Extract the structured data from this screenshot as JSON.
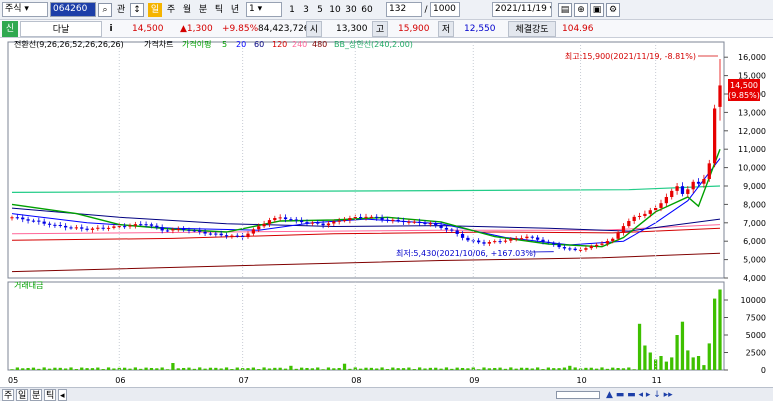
{
  "toolbar": {
    "market": "주식",
    "code": "064260",
    "search_icon": "search-icon",
    "related": "관",
    "pct_mode": "↕",
    "period_badge": "일",
    "periods": [
      "주",
      "월",
      "분",
      "틱",
      "년"
    ],
    "interval": "1",
    "intervals": [
      "1",
      "3",
      "5",
      "10",
      "30",
      "60"
    ],
    "display_count": "132",
    "count_sep": "/",
    "max_count": "1000",
    "date": "2021/11/19",
    "tool_icons": [
      "print-icon",
      "zoom-icon",
      "save-icon",
      "settings-icon"
    ]
  },
  "info": {
    "badge": "신",
    "name": "다날",
    "info_icon": "i",
    "price": "14,500",
    "change": "▲1,300",
    "change_pct": "+9.85%",
    "volume": "84,423,726",
    "open_label": "시",
    "open": "13,300",
    "high_label": "고",
    "high": "15,900",
    "low_label": "저",
    "low": "12,550",
    "strength_label": "체결강도",
    "strength": "104.96"
  },
  "legend": {
    "ichimoku": "전환선(9,26,26,52,26,26,26)",
    "price_chart": "가격차트",
    "ma_label": "가격이평",
    "ma_periods": [
      "5",
      "20",
      "60",
      "120",
      "240",
      "480"
    ],
    "ma_colors": [
      "#00a000",
      "#0000ff",
      "#000080",
      "#d40000",
      "#ff6699",
      "#800000"
    ],
    "bb": "BB_상한선(240,2.00)",
    "volume_pane": "거래대금"
  },
  "annotations": {
    "high": "최고:15,900(2021/11/19, -8.81%)",
    "low": "최저:5,430(2021/10/06, +167.03%)",
    "last_price": "14,500",
    "last_pct": "(9.85%)"
  },
  "colors": {
    "up": "#e60000",
    "down": "#0000e6",
    "volume": "#3ec000",
    "bb_upper": "#22cc88",
    "ichimoku_conv": "#00a000",
    "ichimoku_base": "#0000ff"
  },
  "chart_data": {
    "type": "candlestick",
    "xlabels": [
      "05",
      "06",
      "07",
      "08",
      "09",
      "10",
      "11"
    ],
    "ylim": [
      4000,
      16500
    ],
    "yticks": [
      4000,
      5000,
      6000,
      7000,
      8000,
      9000,
      10000,
      11000,
      12000,
      13000,
      14000,
      15000,
      16000
    ],
    "ytick_labels": [
      "4,000",
      "5,000",
      "6,000",
      "7,000",
      "8,000",
      "9,000",
      "10,000",
      "11,000",
      "12,000",
      "13,000",
      "14,000",
      "15,000",
      "16,000"
    ],
    "close_path": [
      [
        0,
        7300
      ],
      [
        4,
        7100
      ],
      [
        8,
        6850
      ],
      [
        14,
        6650
      ],
      [
        20,
        6800
      ],
      [
        25,
        6950
      ],
      [
        28,
        6600
      ],
      [
        32,
        6650
      ],
      [
        36,
        6450
      ],
      [
        40,
        6300
      ],
      [
        43,
        6250
      ],
      [
        46,
        6800
      ],
      [
        48,
        7150
      ],
      [
        50,
        7300
      ],
      [
        53,
        7100
      ],
      [
        58,
        6900
      ],
      [
        63,
        7250
      ],
      [
        66,
        7350
      ],
      [
        70,
        7150
      ],
      [
        74,
        7050
      ],
      [
        78,
        6950
      ],
      [
        82,
        6550
      ],
      [
        85,
        6050
      ],
      [
        88,
        5900
      ],
      [
        92,
        6050
      ],
      [
        96,
        6250
      ],
      [
        99,
        6000
      ],
      [
        102,
        5700
      ],
      [
        105,
        5500
      ],
      [
        108,
        5700
      ],
      [
        110,
        5900
      ],
      [
        112,
        6100
      ],
      [
        114,
        6850
      ],
      [
        116,
        7300
      ],
      [
        118,
        7500
      ],
      [
        120,
        7800
      ],
      [
        122,
        8400
      ],
      [
        124,
        9000
      ],
      [
        125,
        8600
      ],
      [
        126,
        8800
      ],
      [
        127,
        9200
      ],
      [
        128,
        9150
      ],
      [
        129,
        9400
      ],
      [
        130,
        10200
      ],
      [
        131,
        13200
      ],
      [
        132,
        14500
      ]
    ],
    "volume": {
      "ylim": [
        0,
        12000
      ],
      "yticks": [
        0,
        2500,
        5000,
        7500,
        10000
      ],
      "ytick_labels": [
        "0",
        "2500",
        "5000",
        "7500",
        "10000"
      ],
      "spikes": [
        [
          30,
          1000
        ],
        [
          52,
          600
        ],
        [
          62,
          900
        ],
        [
          104,
          600
        ],
        [
          117,
          6600
        ],
        [
          118,
          3500
        ],
        [
          119,
          2500
        ],
        [
          120,
          1500
        ],
        [
          121,
          2000
        ],
        [
          122,
          1200
        ],
        [
          123,
          1800
        ],
        [
          124,
          5000
        ],
        [
          125,
          6900
        ],
        [
          126,
          2800
        ],
        [
          127,
          1800
        ],
        [
          128,
          2000
        ],
        [
          129,
          700
        ],
        [
          130,
          3800
        ],
        [
          131,
          10200
        ],
        [
          132,
          11500
        ]
      ]
    },
    "series": [
      {
        "name": "BB_상한선",
        "points": [
          [
            0,
            8650
          ],
          [
            40,
            8700
          ],
          [
            80,
            8750
          ],
          [
            115,
            8800
          ],
          [
            132,
            9000
          ]
        ]
      },
      {
        "name": "480",
        "points": [
          [
            0,
            4350
          ],
          [
            40,
            4650
          ],
          [
            80,
            4950
          ],
          [
            110,
            5100
          ],
          [
            132,
            5350
          ]
        ]
      },
      {
        "name": "240",
        "points": [
          [
            0,
            6400
          ],
          [
            40,
            6500
          ],
          [
            80,
            6600
          ],
          [
            110,
            6600
          ],
          [
            132,
            6900
          ]
        ]
      },
      {
        "name": "120",
        "points": [
          [
            0,
            6050
          ],
          [
            30,
            6150
          ],
          [
            60,
            6400
          ],
          [
            90,
            6500
          ],
          [
            112,
            6450
          ],
          [
            132,
            6700
          ]
        ]
      },
      {
        "name": "60",
        "points": [
          [
            0,
            7800
          ],
          [
            20,
            7300
          ],
          [
            40,
            6950
          ],
          [
            60,
            6800
          ],
          [
            80,
            6850
          ],
          [
            100,
            6700
          ],
          [
            115,
            6550
          ],
          [
            132,
            7200
          ]
        ]
      },
      {
        "name": "20",
        "points": [
          [
            0,
            7500
          ],
          [
            14,
            7000
          ],
          [
            30,
            6700
          ],
          [
            46,
            6600
          ],
          [
            56,
            7000
          ],
          [
            66,
            7200
          ],
          [
            80,
            6950
          ],
          [
            92,
            6200
          ],
          [
            104,
            5800
          ],
          [
            114,
            6000
          ],
          [
            120,
            7000
          ],
          [
            126,
            8200
          ],
          [
            132,
            10500
          ]
        ]
      },
      {
        "name": "전환선",
        "points": [
          [
            0,
            8000
          ],
          [
            12,
            7500
          ],
          [
            20,
            6900
          ],
          [
            30,
            6650
          ],
          [
            40,
            6500
          ],
          [
            50,
            7100
          ],
          [
            60,
            7150
          ],
          [
            70,
            7300
          ],
          [
            80,
            7050
          ],
          [
            90,
            6250
          ],
          [
            100,
            5850
          ],
          [
            110,
            5700
          ],
          [
            114,
            6200
          ],
          [
            120,
            7600
          ],
          [
            126,
            8400
          ],
          [
            128,
            7900
          ],
          [
            132,
            11000
          ]
        ]
      }
    ]
  }
}
